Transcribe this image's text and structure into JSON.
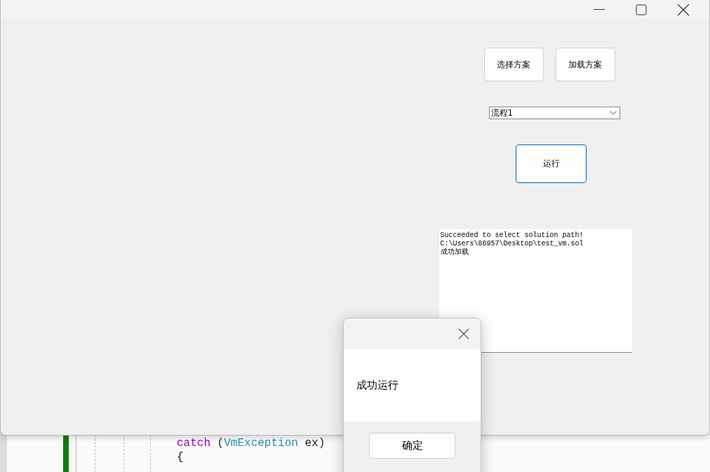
{
  "main_window": {
    "buttons": [
      {
        "label": "选择方案"
      },
      {
        "label": "加载方案"
      }
    ],
    "process_select": {
      "value": "流程1"
    },
    "run_button": {
      "label": "运行",
      "focused": true
    },
    "log": {
      "lines": [
        "Succeeded to select solution path!",
        "C:\\Users\\86957\\Desktop\\test_vm.sol",
        "成功加载"
      ]
    }
  },
  "message_dialog": {
    "message": "成功运行",
    "ok_button": "确定"
  },
  "code_editor": {
    "lines": [
      {
        "parts": [
          [
            {
              "kind": "keyword",
              "text": "catch"
            },
            {
              "kind": "plain",
              "text": " ("
            },
            {
              "kind": "type",
              "text": "VmException"
            },
            {
              "kind": "plain",
              "text": " ex)"
            }
          ]
        ]
      },
      {
        "parts": [
          [
            {
              "kind": "plain",
              "text": "{"
            }
          ]
        ]
      }
    ]
  }
}
